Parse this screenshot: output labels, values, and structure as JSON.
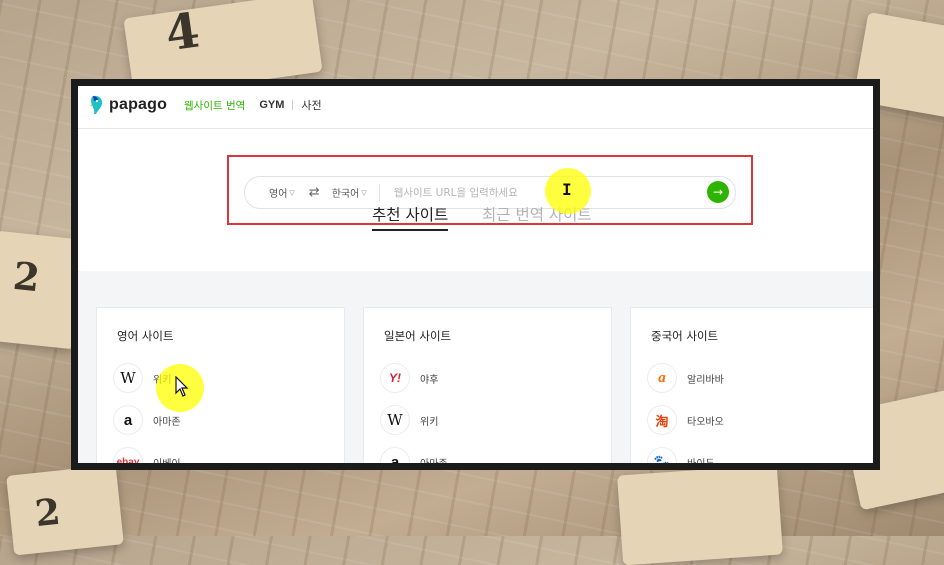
{
  "header": {
    "logo_text": "papago",
    "nav": {
      "website_translate": "웹사이트 번역",
      "gym": "GYM",
      "dictionary": "사전"
    }
  },
  "search": {
    "source_lang": "영어",
    "target_lang": "한국어",
    "url_placeholder": "웹사이트 URL을 입력하세요",
    "submit_icon": "arrow-right-icon"
  },
  "tabs": {
    "recommended": "추천 사이트",
    "recent": "최근 번역 사이트"
  },
  "cards": [
    {
      "title": "영어 사이트",
      "items": [
        {
          "icon": "wikipedia-icon",
          "glyph": "W",
          "label": "위키"
        },
        {
          "icon": "amazon-icon",
          "glyph": "a",
          "label": "아마존"
        },
        {
          "icon": "ebay-icon",
          "glyph": "ebay",
          "label": "이베이"
        }
      ]
    },
    {
      "title": "일본어 사이트",
      "items": [
        {
          "icon": "yahoo-icon",
          "glyph": "Y!",
          "label": "야후"
        },
        {
          "icon": "wikipedia-icon",
          "glyph": "W",
          "label": "위키"
        },
        {
          "icon": "amazon-icon",
          "glyph": "a",
          "label": "아마존"
        }
      ]
    },
    {
      "title": "중국어 사이트",
      "items": [
        {
          "icon": "alibaba-icon",
          "glyph": "a",
          "label": "알리바바"
        },
        {
          "icon": "taobao-icon",
          "glyph": "淘",
          "label": "타오바오"
        },
        {
          "icon": "baidu-icon",
          "glyph": "🐾",
          "label": "바이두"
        }
      ]
    }
  ],
  "colors": {
    "accent": "#2db400",
    "highlight_box": "#d9363e",
    "cursor_halo": "#ffff00"
  }
}
